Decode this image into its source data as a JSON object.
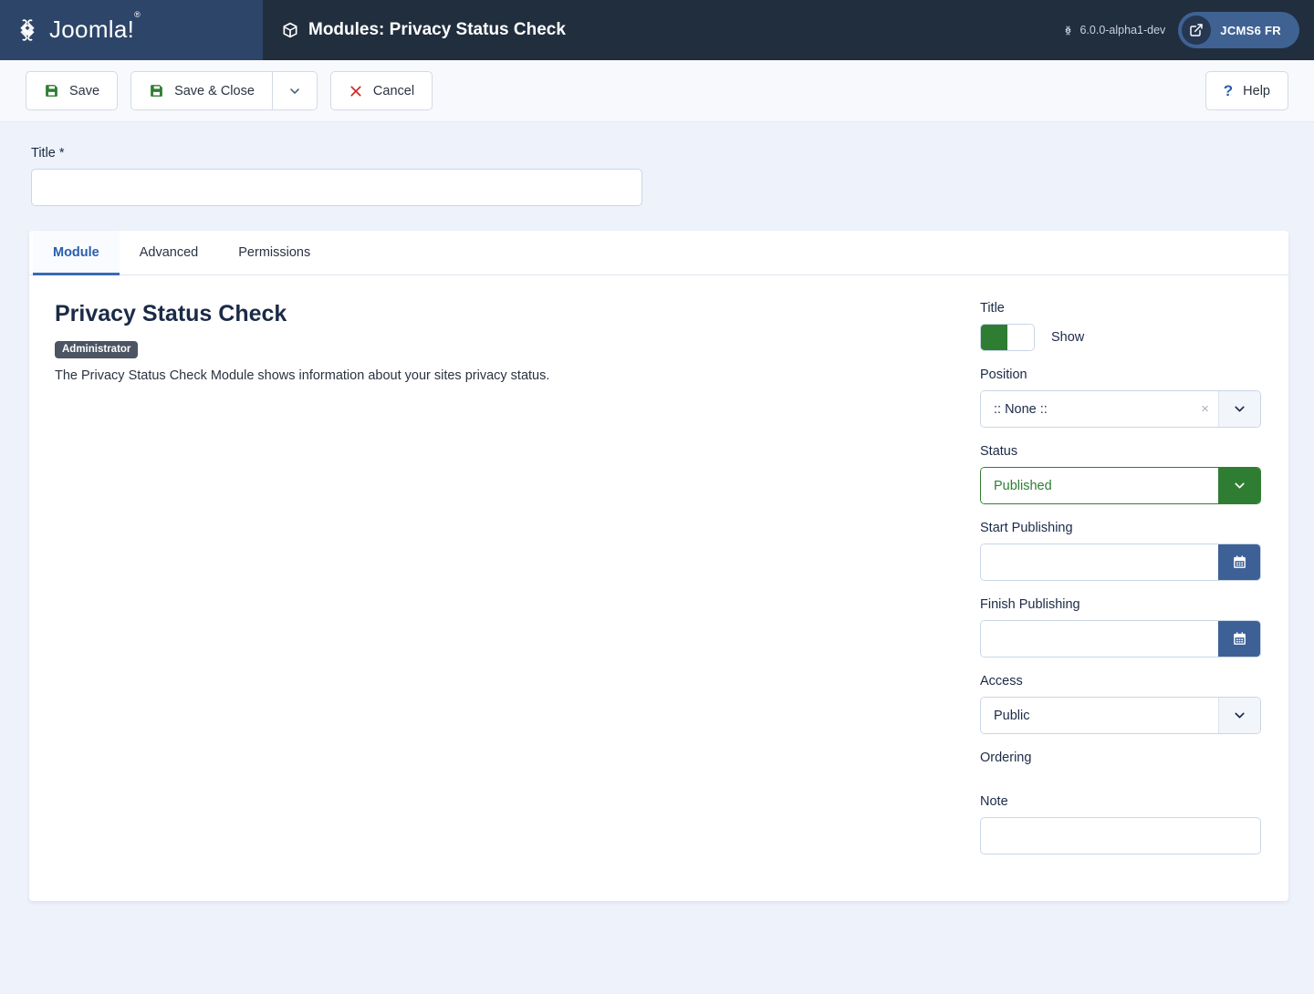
{
  "header": {
    "brand": "Joomla!",
    "brand_registered": "®",
    "page_title": "Modules: Privacy Status Check",
    "version": "6.0.0-alpha1-dev",
    "site_button_label": "JCMS6 FR",
    "logo_panel_color": "#2d4568",
    "bar_color": "#212e3e"
  },
  "toolbar": {
    "save_label": "Save",
    "save_close_label": "Save & Close",
    "cancel_label": "Cancel",
    "help_label": "Help",
    "help_icon_glyph": "?",
    "save_icon_color": "#2f7d32",
    "cancel_icon_color": "#cf2b2b"
  },
  "form": {
    "title_label": "Title *",
    "title_value": "",
    "title_placeholder": ""
  },
  "tabs": [
    {
      "label": "Module",
      "active": true
    },
    {
      "label": "Advanced",
      "active": false
    },
    {
      "label": "Permissions",
      "active": false
    }
  ],
  "module": {
    "name": "Privacy Status Check",
    "client_badge": "Administrator",
    "description": "The Privacy Status Check Module shows information about your sites privacy status."
  },
  "sidebar": {
    "title_field": {
      "label": "Title",
      "toggle_state": "on",
      "toggle_text": "Show",
      "accent": "#2f7d32"
    },
    "position": {
      "label": "Position",
      "value": ":: None ::",
      "clear_glyph": "×"
    },
    "status": {
      "label": "Status",
      "value": "Published",
      "accent": "#2f7d32"
    },
    "start_publishing": {
      "label": "Start Publishing",
      "value": "",
      "button_color": "#3d6196"
    },
    "finish_publishing": {
      "label": "Finish Publishing",
      "value": "",
      "button_color": "#3d6196"
    },
    "access": {
      "label": "Access",
      "value": "Public"
    },
    "ordering": {
      "label": "Ordering"
    },
    "note": {
      "label": "Note",
      "value": ""
    }
  }
}
